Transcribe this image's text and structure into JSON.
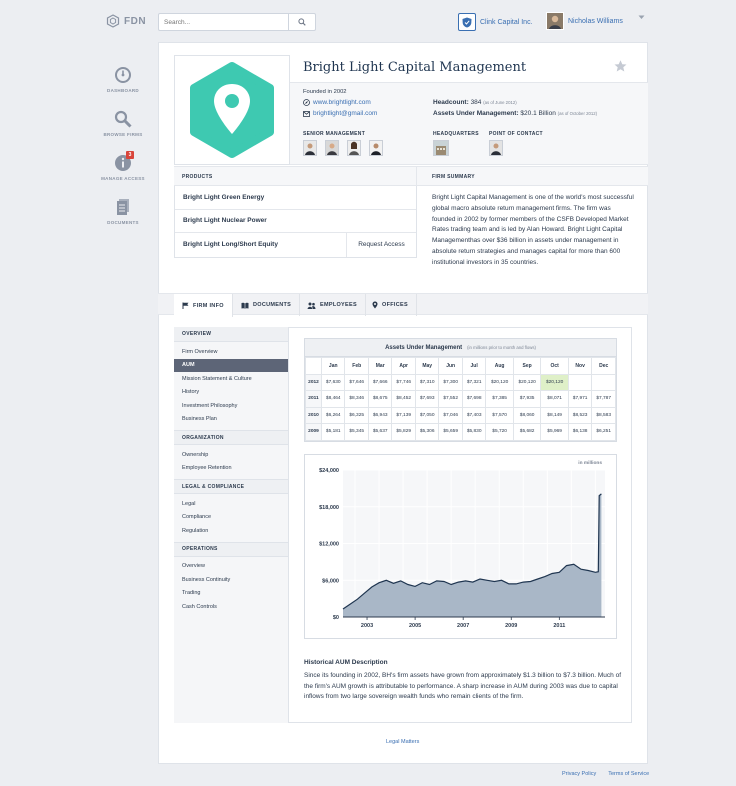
{
  "app": {
    "logo_text": "FDN"
  },
  "search": {
    "placeholder": "Search..."
  },
  "header": {
    "company_name": "Clink Capital Inc.",
    "user_name": "Nicholas Williams"
  },
  "sidenav": [
    {
      "label": "DASHBOARD",
      "icon": "gauge-icon"
    },
    {
      "label": "BROWSE FIRMS",
      "icon": "magnifier-icon"
    },
    {
      "label": "MANAGE ACCESS",
      "icon": "info-icon",
      "badge": "3"
    },
    {
      "label": "DOCUMENTS",
      "icon": "documents-icon"
    }
  ],
  "firm": {
    "name": "Bright Light Capital Management",
    "founded": "Founded in 2002",
    "website": "www.brightlight.com",
    "email": "brightlight@gmail.com",
    "headcount_label": "Headcount:",
    "headcount_value": "384",
    "headcount_note": "(as of June 2012)",
    "aum_label": "Assets Under Management:",
    "aum_value": "$20.1 Billion",
    "aum_note": "(as of October 2012)",
    "senior_mgmt_label": "SENIOR MANAGEMENT",
    "hq_label": "HEADQUARTERS",
    "poc_label": "POINT OF CONTACT",
    "brand_color": "#3ec9b1"
  },
  "products": {
    "header": "PRODUCTS",
    "items": [
      "Bright Light Green Energy",
      "Bright Light Nuclear Power",
      "Bright Light Long/Short Equity"
    ],
    "request_label": "Request Access"
  },
  "summary": {
    "header": "FIRM SUMMARY",
    "text": "Bright Light Capital Management is one of the world's most successful global macro absolute return management firms. The firm was founded in 2002 by former members of the CSFB Developed Market Rates trading team and is led by Alan Howard. Bright Light Capital Managementhas over $36 billion in assets under management in absolute return strategies and manages capital for more than 600 institutional investors in 35 countries."
  },
  "tabs": [
    {
      "label": "FIRM INFO",
      "icon": "flag-icon"
    },
    {
      "label": "DOCUMENTS",
      "icon": "book-icon"
    },
    {
      "label": "EMPLOYEES",
      "icon": "people-icon"
    },
    {
      "label": "OFFICES",
      "icon": "pin-icon"
    }
  ],
  "menu": [
    {
      "group": "OVERVIEW",
      "items": [
        "Firm Overview",
        "AUM",
        "Mission Statement & Culture",
        "History",
        "Investment Philosophy",
        "Business Plan"
      ]
    },
    {
      "group": "ORGANIZATION",
      "items": [
        "Ownership",
        "Employee Retention"
      ]
    },
    {
      "group": "LEGAL & COMPLIANCE",
      "items": [
        "Legal",
        "Compliance",
        "Regulation"
      ]
    },
    {
      "group": "OPERATIONS",
      "items": [
        "Overview",
        "Business Continuity",
        "Trading",
        "Cash Controls"
      ]
    }
  ],
  "aum_table": {
    "title": "Assets Under Management",
    "note": "(in millions prior to month and flows)",
    "months": [
      "Jan",
      "Feb",
      "Mar",
      "Apr",
      "May",
      "Jun",
      "Jul",
      "Aug",
      "Sep",
      "Oct",
      "Nov",
      "Dec"
    ],
    "rows": [
      {
        "year": "2012",
        "values": [
          "$7,630",
          "$7,646",
          "$7,666",
          "$7,746",
          "$7,310",
          "$7,300",
          "$7,321",
          "$20,120",
          "$20,120",
          "$20,120",
          "",
          ""
        ]
      },
      {
        "year": "2011",
        "values": [
          "$8,464",
          "$8,346",
          "$8,675",
          "$8,452",
          "$7,693",
          "$7,552",
          "$7,698",
          "$7,385",
          "$7,935",
          "$8,071",
          "$7,971",
          "$7,787"
        ]
      },
      {
        "year": "2010",
        "values": [
          "$6,264",
          "$6,325",
          "$6,943",
          "$7,139",
          "$7,050",
          "$7,046",
          "$7,403",
          "$7,570",
          "$8,060",
          "$8,149",
          "$8,523",
          "$8,583"
        ]
      },
      {
        "year": "2009",
        "values": [
          "$5,181",
          "$5,345",
          "$5,637",
          "$5,829",
          "$5,306",
          "$5,659",
          "$5,830",
          "$5,720",
          "$5,682",
          "$5,969",
          "$6,138",
          "$6,251"
        ]
      }
    ]
  },
  "chart_data": {
    "type": "area",
    "title": "",
    "unit_label": "in millions",
    "xlabel": "",
    "ylabel": "",
    "ylim": [
      0,
      24000
    ],
    "yticks": [
      "$0",
      "$6,000",
      "$12,000",
      "$18,000",
      "$24,000"
    ],
    "xticks": [
      "2003",
      "2005",
      "2007",
      "2009",
      "2011"
    ],
    "xlim": [
      2002,
      2012.9
    ],
    "x": [
      2002.0,
      2002.3,
      2002.6,
      2002.9,
      2003.2,
      2003.5,
      2003.8,
      2004.1,
      2004.4,
      2004.7,
      2005.0,
      2005.3,
      2005.6,
      2005.9,
      2006.2,
      2006.5,
      2006.8,
      2007.1,
      2007.4,
      2007.7,
      2008.0,
      2008.3,
      2008.6,
      2008.9,
      2009.2,
      2009.5,
      2009.8,
      2010.1,
      2010.4,
      2010.7,
      2011.0,
      2011.3,
      2011.6,
      2011.9,
      2012.2,
      2012.5,
      2012.62,
      2012.66,
      2012.75
    ],
    "values": [
      1300,
      2100,
      2900,
      3900,
      4900,
      5600,
      6000,
      5500,
      5900,
      5300,
      5000,
      5600,
      5300,
      5900,
      5800,
      5300,
      5700,
      5900,
      5700,
      6200,
      6000,
      5800,
      6000,
      5400,
      5400,
      5700,
      5800,
      6200,
      6600,
      7100,
      7300,
      8400,
      8600,
      7800,
      7600,
      7300,
      7400,
      19800,
      20100
    ]
  },
  "history": {
    "title": "Historical AUM Description",
    "text": "Since its founding in 2002, BH's firm assets have grown from approximately $1.3 billion to $7.3 billion. Much of the firm's AUM growth is attributable to performance. A sharp increase in AUM during 2003 was due to capital inflows from two large sovereign wealth funds who remain clients of the firm."
  },
  "footer": {
    "legal": "Legal Matters",
    "privacy": "Privacy Policy",
    "terms": "Terms of Service"
  }
}
